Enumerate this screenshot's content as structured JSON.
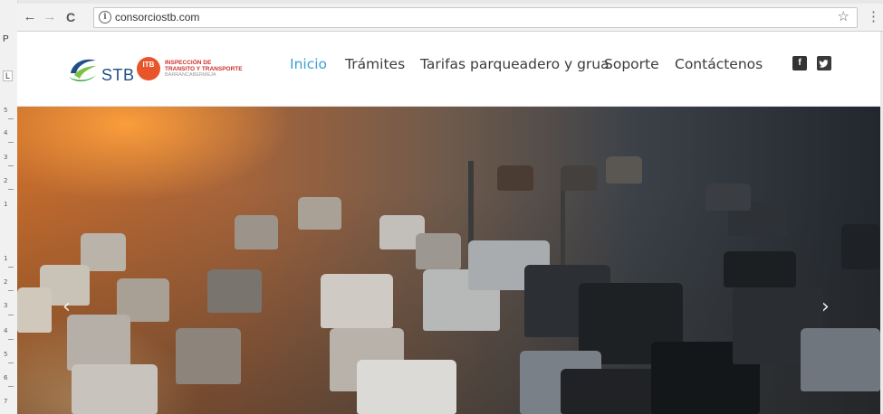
{
  "browser": {
    "url": "consorciostb.com",
    "back_icon": "←",
    "forward_icon": "→",
    "reload_icon": "C",
    "info_icon": "i",
    "star_icon": "☆",
    "menu_icon": "⋮"
  },
  "side_ruler": {
    "p_label": "P",
    "l_label": "L",
    "numbers": [
      "5",
      "4",
      "3",
      "2",
      "1",
      "1",
      "2",
      "3",
      "4",
      "5",
      "6",
      "7"
    ]
  },
  "site": {
    "logo_text": "STB",
    "itb_badge": "ITB",
    "itb_line1": "INSPECCIÓN DE",
    "itb_line2": "TRANSITO Y TRANSPORTE",
    "itb_line3": "BARRANCABERMEJA",
    "nav": {
      "inicio": "Inicio",
      "tramites": "Trámites",
      "tarifas": "Tarifas parqueadero y grua",
      "soporte": "Soporte",
      "contactenos": "Contáctenos"
    },
    "facebook": "f",
    "twitter": "t",
    "accent_color": "#3b9fd8"
  },
  "hero": {
    "prev_arrow": "‹",
    "next_arrow": "›"
  }
}
